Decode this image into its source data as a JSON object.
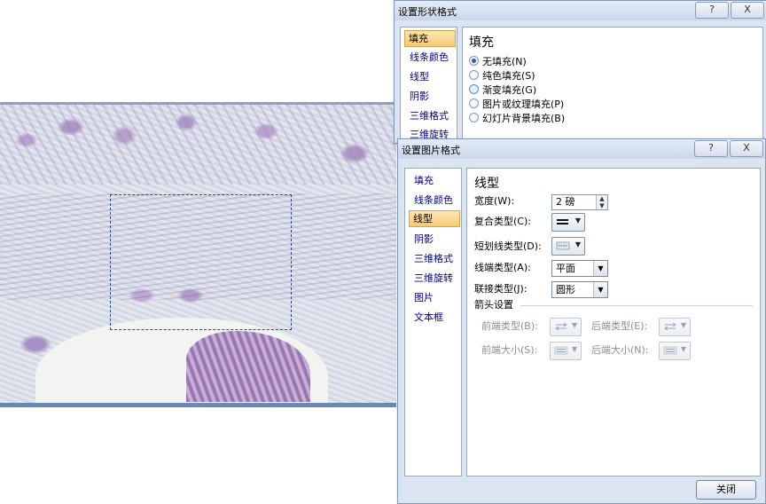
{
  "dialog_back": {
    "title": "设置形状格式",
    "help": "?",
    "close": "X",
    "nav": [
      "填充",
      "线条颜色",
      "线型",
      "阴影",
      "三维格式",
      "三维旋转"
    ],
    "section_title": "填充",
    "options": [
      "无填充(N)",
      "纯色填充(S)",
      "渐变填充(G)",
      "图片或纹理填充(P)",
      "幻灯片背景填充(B)"
    ]
  },
  "dialog_front": {
    "title": "设置图片格式",
    "help": "?",
    "close": "X",
    "nav": [
      "填充",
      "线条颜色",
      "线型",
      "阴影",
      "三维格式",
      "三维旋转",
      "图片",
      "文本框"
    ],
    "section_title": "线型",
    "width_label": "宽度(W):",
    "width_value": "2 磅",
    "compound_label": "复合类型(C):",
    "dash_label": "短划线类型(D):",
    "cap_label": "线端类型(A):",
    "cap_value": "平面",
    "join_label": "联接类型(J):",
    "join_value": "圆形",
    "arrow_group_label": "箭头设置",
    "begin_type_label": "前端类型(B):",
    "end_type_label": "后端类型(E):",
    "begin_size_label": "前端大小(S):",
    "end_size_label": "后端大小(N):",
    "close_button": "关闭"
  },
  "colors": {
    "dialog_bg": "#dbe5f1",
    "selected_nav": "#f7c977",
    "selection_border": "#2c4d8a"
  }
}
